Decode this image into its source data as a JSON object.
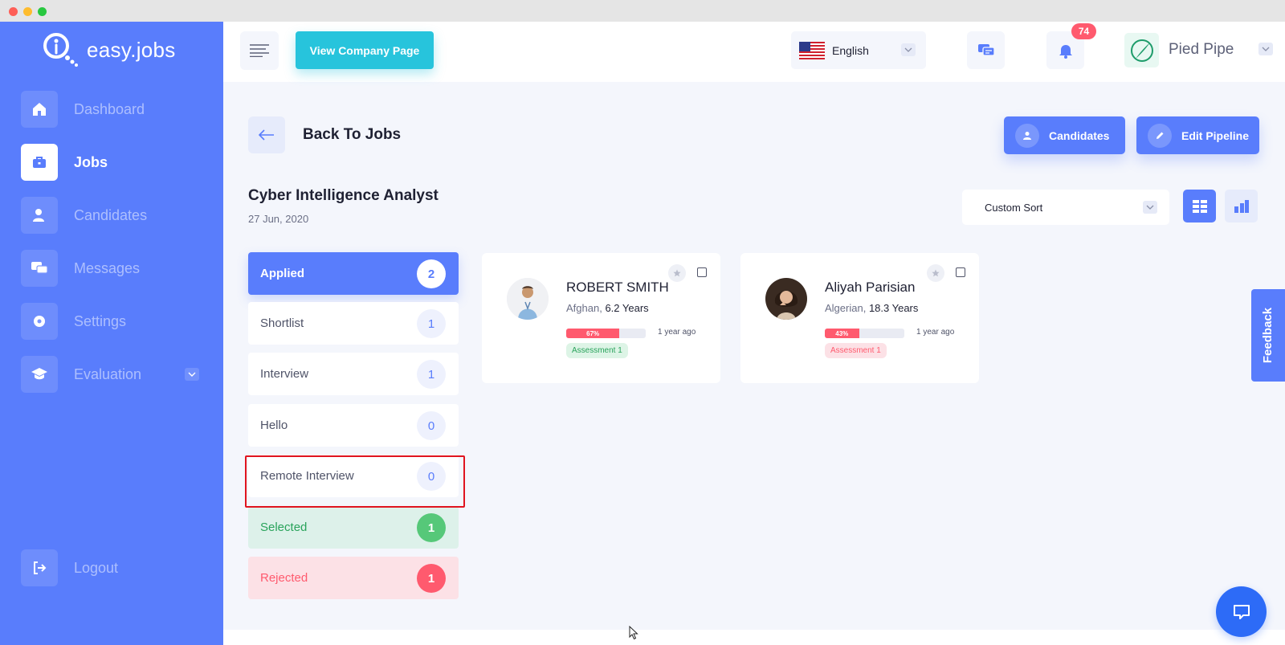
{
  "app": {
    "name": "easy.jobs"
  },
  "sidebar": {
    "items": [
      {
        "label": "Dashboard",
        "icon": "home-icon",
        "active": false
      },
      {
        "label": "Jobs",
        "icon": "briefcase-icon",
        "active": true
      },
      {
        "label": "Candidates",
        "icon": "user-icon",
        "active": false
      },
      {
        "label": "Messages",
        "icon": "chat-icon",
        "active": false
      },
      {
        "label": "Settings",
        "icon": "gear-icon",
        "active": false
      },
      {
        "label": "Evaluation",
        "icon": "graduation-cap-icon",
        "active": false
      }
    ],
    "logout_label": "Logout"
  },
  "topbar": {
    "view_company_label": "View Company Page",
    "language": "English",
    "notification_count": "74",
    "company_name": "Pied Pipe"
  },
  "page": {
    "back_label": "Back To Jobs",
    "candidates_button": "Candidates",
    "edit_pipeline_button": "Edit Pipeline",
    "job_title": "Cyber Intelligence Analyst",
    "job_date": "27 Jun, 2020",
    "sort_label": "Custom Sort"
  },
  "stages": [
    {
      "label": "Applied",
      "count": "2"
    },
    {
      "label": "Shortlist",
      "count": "1"
    },
    {
      "label": "Interview",
      "count": "1"
    },
    {
      "label": "Hello",
      "count": "0"
    },
    {
      "label": "Remote Interview",
      "count": "0"
    },
    {
      "label": "Selected",
      "count": "1"
    },
    {
      "label": "Rejected",
      "count": "1"
    }
  ],
  "candidates": [
    {
      "name": "ROBERT SMITH",
      "nationality": "Afghan,",
      "experience": "6.2 Years",
      "score": 0.67,
      "score_label": "67%",
      "time": "1 year ago",
      "tag": "Assessment 1",
      "tag_status": "passed"
    },
    {
      "name": "Aliyah Parisian",
      "nationality": "Algerian,",
      "experience": "18.3 Years",
      "score": 0.43,
      "score_label": "43%",
      "time": "1 year ago",
      "tag": "Assessment 1",
      "tag_status": "failed"
    }
  ],
  "feedback_label": "Feedback",
  "colors": {
    "primary": "#597dfc",
    "accent": "#27c4dc",
    "success": "#29a35b",
    "danger": "#ff5a6e"
  }
}
